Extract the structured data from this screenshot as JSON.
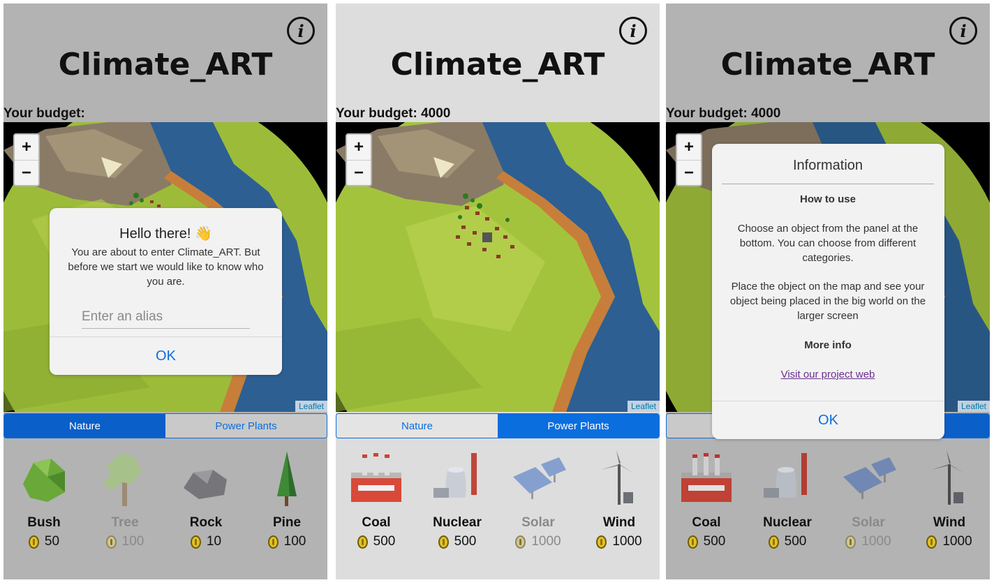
{
  "app": {
    "title": "Climate_ART",
    "info_glyph": "i",
    "leaflet_label": "Leaflet",
    "zoom_in": "+",
    "zoom_out": "−"
  },
  "budget_label": "Your budget:",
  "budget_full": "Your budget: 4000",
  "tabs": {
    "nature": "Nature",
    "power": "Power Plants"
  },
  "nature_items": [
    {
      "name": "Bush",
      "cost": "50",
      "icon": "bush-icon",
      "enabled": true
    },
    {
      "name": "Tree",
      "cost": "100",
      "icon": "tree-icon",
      "enabled": false
    },
    {
      "name": "Rock",
      "cost": "10",
      "icon": "rock-icon",
      "enabled": true
    },
    {
      "name": "Pine",
      "cost": "100",
      "icon": "pine-icon",
      "enabled": true
    }
  ],
  "power_items": [
    {
      "name": "Coal",
      "cost": "500",
      "icon": "coal-plant-icon",
      "enabled": true
    },
    {
      "name": "Nuclear",
      "cost": "500",
      "icon": "nuclear-plant-icon",
      "enabled": true
    },
    {
      "name": "Solar",
      "cost": "1000",
      "icon": "solar-panel-icon",
      "enabled": false
    },
    {
      "name": "Wind",
      "cost": "1000",
      "icon": "wind-turbine-icon",
      "enabled": true
    }
  ],
  "hello_dialog": {
    "title": "Hello there! 👋",
    "text": "You are about to enter Climate_ART. But before we start we would like to know who you are.",
    "placeholder": "Enter an alias",
    "ok": "OK"
  },
  "info_dialog": {
    "title": "Information",
    "how_heading": "How to use",
    "how_text_1": "Choose an object from the panel at the bottom. You can choose from different categories.",
    "how_text_2": "Place the object on the map and see your object being placed in the big world on the larger screen",
    "more_heading": "More info",
    "link": "Visit our project web",
    "ok": "OK"
  },
  "colors": {
    "accent": "#0a6ede",
    "grass": "#9fbf3a",
    "water": "#2d5f93",
    "mountain": "#8b7a62"
  }
}
